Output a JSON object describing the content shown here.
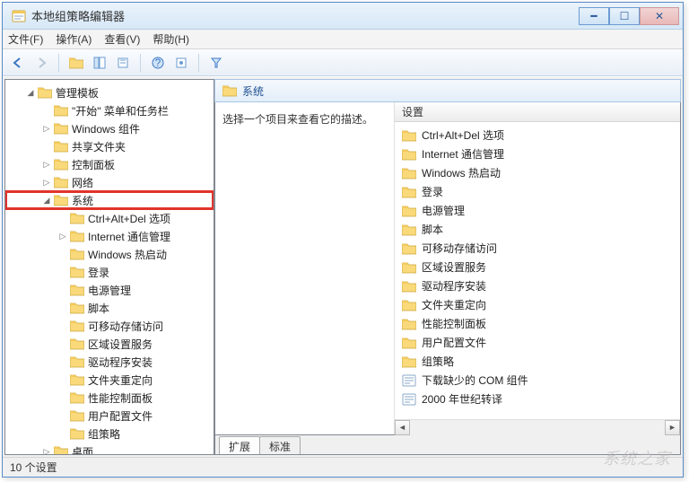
{
  "window": {
    "title": "本地组策略编辑器"
  },
  "menu": {
    "file": "文件(F)",
    "action": "操作(A)",
    "view": "查看(V)",
    "help": "帮助(H)"
  },
  "tree": {
    "root": {
      "label": "管理模板",
      "expanded": true
    },
    "children": [
      {
        "label": "\"开始\" 菜单和任务栏",
        "type": "leaf"
      },
      {
        "label": "Windows 组件",
        "type": "collapsed"
      },
      {
        "label": "共享文件夹",
        "type": "leaf"
      },
      {
        "label": "控制面板",
        "type": "collapsed"
      },
      {
        "label": "网络",
        "type": "collapsed"
      },
      {
        "label": "系统",
        "type": "expanded",
        "highlighted": true,
        "children": [
          {
            "label": "Ctrl+Alt+Del 选项"
          },
          {
            "label": "Internet 通信管理",
            "type": "collapsed"
          },
          {
            "label": "Windows 热启动"
          },
          {
            "label": "登录"
          },
          {
            "label": "电源管理"
          },
          {
            "label": "脚本"
          },
          {
            "label": "可移动存储访问"
          },
          {
            "label": "区域设置服务"
          },
          {
            "label": "驱动程序安装"
          },
          {
            "label": "文件夹重定向"
          },
          {
            "label": "性能控制面板"
          },
          {
            "label": "用户配置文件"
          },
          {
            "label": "组策略"
          }
        ]
      },
      {
        "label": "桌面",
        "type": "collapsed"
      }
    ]
  },
  "right": {
    "header": "系统",
    "description": "选择一个项目来查看它的描述。",
    "columns": {
      "settings": "设置"
    },
    "items": [
      {
        "icon": "folder",
        "label": "Ctrl+Alt+Del 选项"
      },
      {
        "icon": "folder",
        "label": "Internet 通信管理"
      },
      {
        "icon": "folder",
        "label": "Windows 热启动"
      },
      {
        "icon": "folder",
        "label": "登录"
      },
      {
        "icon": "folder",
        "label": "电源管理"
      },
      {
        "icon": "folder",
        "label": "脚本"
      },
      {
        "icon": "folder",
        "label": "可移动存储访问"
      },
      {
        "icon": "folder",
        "label": "区域设置服务"
      },
      {
        "icon": "folder",
        "label": "驱动程序安装"
      },
      {
        "icon": "folder",
        "label": "文件夹重定向"
      },
      {
        "icon": "folder",
        "label": "性能控制面板"
      },
      {
        "icon": "folder",
        "label": "用户配置文件"
      },
      {
        "icon": "folder",
        "label": "组策略"
      },
      {
        "icon": "setting",
        "label": "下载缺少的 COM 组件"
      },
      {
        "icon": "setting",
        "label": "2000 年世纪转译"
      }
    ],
    "tabs": {
      "extended": "扩展",
      "standard": "标准"
    }
  },
  "status": {
    "text": "10 个设置"
  },
  "watermark": "系统之家"
}
